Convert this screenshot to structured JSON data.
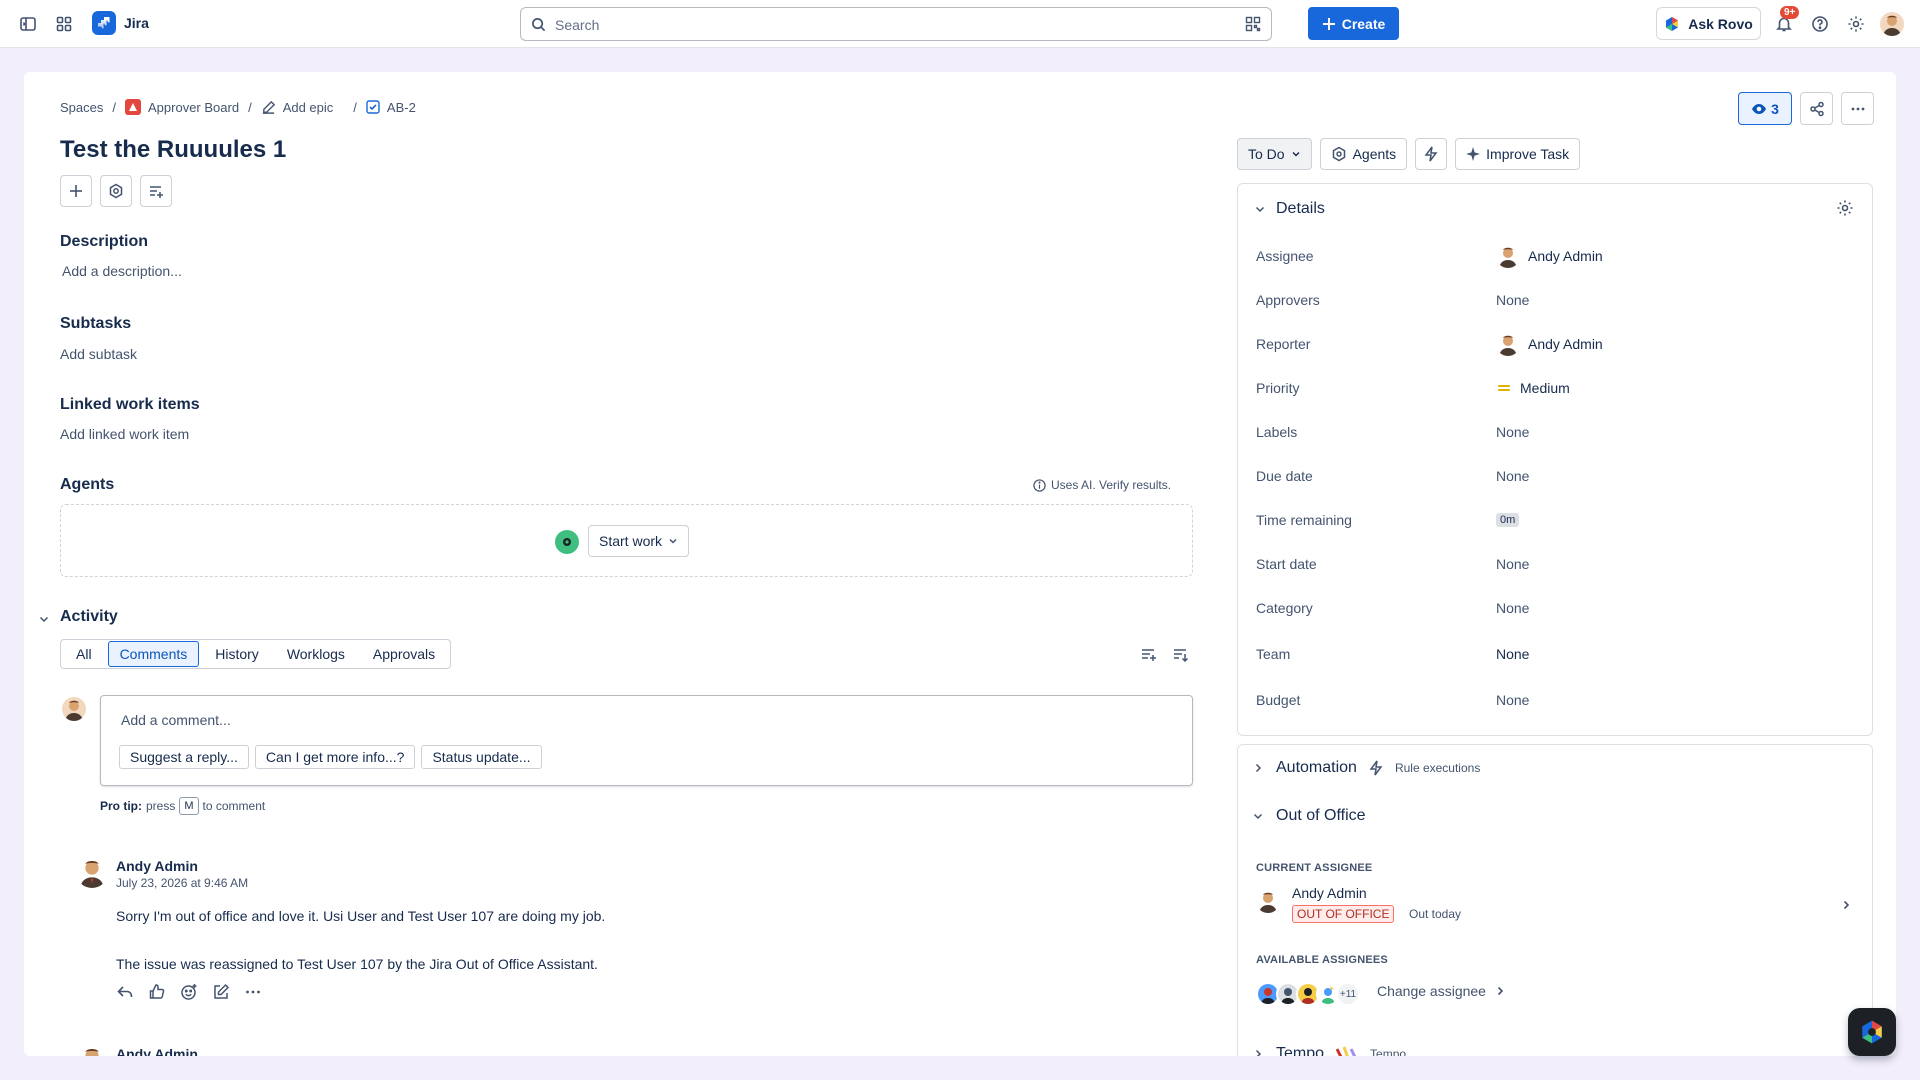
{
  "app": {
    "name": "Jira"
  },
  "search": {
    "placeholder": "Search"
  },
  "topbar": {
    "create_label": "Create",
    "rovo_label": "Ask Rovo",
    "notifications_badge": "9+"
  },
  "breadcrumb": {
    "spaces": "Spaces",
    "project": "Approver Board",
    "epic": "Add epic",
    "issue_key": "AB-2"
  },
  "issue": {
    "title": "Test the Ruuuules 1"
  },
  "sections": {
    "description_title": "Description",
    "description_placeholder": "Add a description...",
    "subtasks_title": "Subtasks",
    "subtasks_action": "Add subtask",
    "linked_title": "Linked work items",
    "linked_action": "Add linked work item",
    "agents_title": "Agents",
    "ai_note": "Uses AI. Verify results.",
    "start_work": "Start work"
  },
  "activity": {
    "title": "Activity",
    "tabs": [
      "All",
      "Comments",
      "History",
      "Worklogs",
      "Approvals"
    ],
    "active_tab": "Comments",
    "comment_placeholder": "Add a comment...",
    "suggestions": [
      "Suggest a reply...",
      "Can I get more info...?",
      "Status update..."
    ],
    "protip_label": "Pro tip:",
    "protip_press": "press",
    "protip_key": "M",
    "protip_suffix": "to comment",
    "comments": [
      {
        "author": "Andy Admin",
        "date": "July 23, 2026 at 9:46 AM",
        "line1": "Sorry I'm out of office and love it. Usi User and Test User 107 are doing my job.",
        "line2": "The issue was reassigned to Test User 107 by the Jira Out of Office Assistant."
      },
      {
        "author": "Andy Admin"
      }
    ]
  },
  "status": {
    "current": "To Do",
    "agents": "Agents",
    "improve": "Improve Task"
  },
  "watchers": {
    "count": "3"
  },
  "details": {
    "title": "Details",
    "fields": [
      {
        "label": "Assignee",
        "value": "Andy Admin",
        "kind": "user"
      },
      {
        "label": "Approvers",
        "value": "None",
        "kind": "none"
      },
      {
        "label": "Reporter",
        "value": "Andy Admin",
        "kind": "user"
      },
      {
        "label": "Priority",
        "value": "Medium",
        "kind": "priority"
      },
      {
        "label": "Labels",
        "value": "None",
        "kind": "none"
      },
      {
        "label": "Due date",
        "value": "None",
        "kind": "none"
      },
      {
        "label": "Time remaining",
        "value": "0m",
        "kind": "pill"
      },
      {
        "label": "Start date",
        "value": "None",
        "kind": "none"
      },
      {
        "label": "Category",
        "value": "None",
        "kind": "none"
      },
      {
        "label": "Team",
        "value": "None",
        "kind": "text"
      },
      {
        "label": "Budget",
        "value": "None",
        "kind": "none"
      }
    ]
  },
  "automation": {
    "title": "Automation",
    "sub": "Rule executions"
  },
  "ooo": {
    "title": "Out of Office",
    "current_label": "CURRENT ASSIGNEE",
    "user": "Andy Admin",
    "lozenge": "OUT OF OFFICE",
    "today": "Out today",
    "available_label": "AVAILABLE ASSIGNEES",
    "more_count": "+11",
    "change_label": "Change assignee"
  },
  "tempo": {
    "title": "Tempo",
    "sub": "Tempo"
  },
  "colors": {
    "brand": "#1868db",
    "success": "#3fbf7f",
    "danger": "#ae2e24",
    "priority_medium": "#e2b203"
  }
}
